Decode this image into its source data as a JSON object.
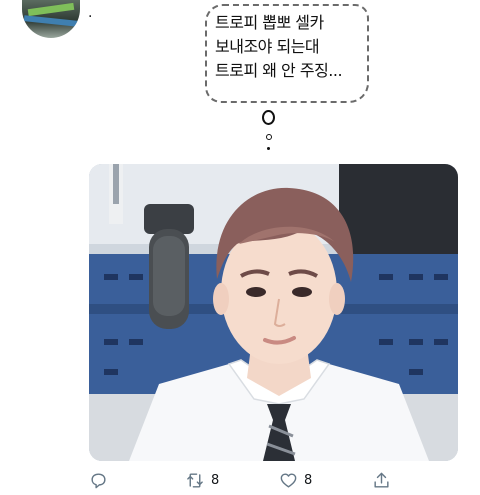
{
  "tweet": {
    "avatar_icon": "profile-avatar",
    "menu_glyph": ".",
    "thought_lines": [
      "트로피 뽑뽀 셀카",
      "보내조야 되는대",
      "트로피 왜 안 주징..."
    ],
    "thought_tail_letter": "o"
  },
  "actions": {
    "reply": {
      "icon": "reply-icon",
      "count": ""
    },
    "retweet": {
      "icon": "retweet-icon",
      "count": "8"
    },
    "like": {
      "icon": "like-icon",
      "count": "8"
    },
    "share": {
      "icon": "share-icon",
      "count": ""
    }
  },
  "colors": {
    "icon_gray": "#657786",
    "text": "#14171a",
    "backdrop_blue": "#3a5f9a"
  }
}
